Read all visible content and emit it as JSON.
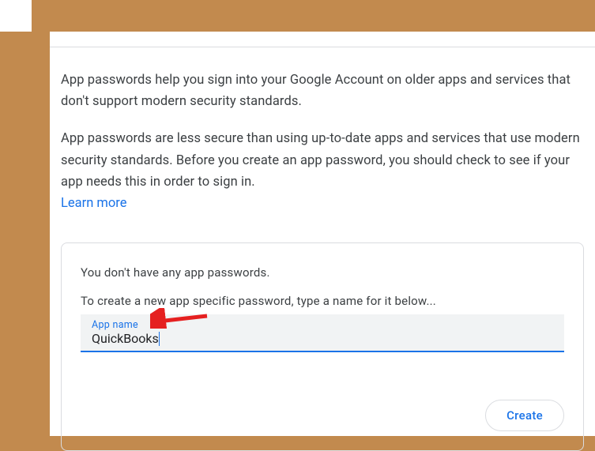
{
  "intro": {
    "p1": "App passwords help you sign into your Google Account on older apps and services that don't support modern security standards.",
    "p2": "App passwords are less secure than using up-to-date apps and services that use modern security standards. Before you create an app password, you should check to see if your app needs this in order to sign in.",
    "learn_more": "Learn more"
  },
  "card": {
    "no_passwords_text": "You don't have any app passwords.",
    "create_instruction": "To create a new app specific password, type a name for it below...",
    "input_label": "App name",
    "input_value": "QuickBooks",
    "create_button": "Create"
  }
}
